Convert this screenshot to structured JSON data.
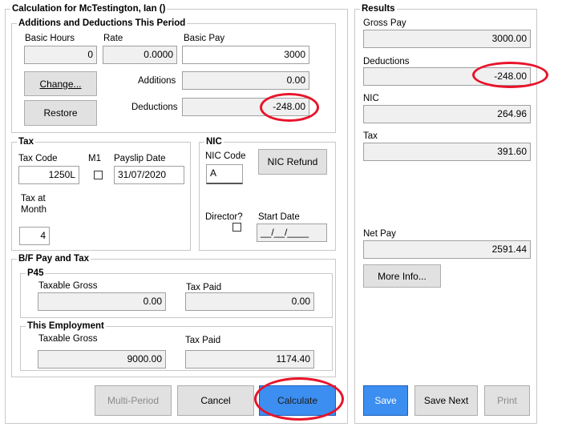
{
  "calc": {
    "title": "Calculation for McTestington, Ian ()",
    "additions_group": {
      "title": "Additions and Deductions This Period",
      "basic_hours_label": "Basic Hours",
      "basic_hours_value": "0",
      "rate_label": "Rate",
      "rate_value": "0.0000",
      "basic_pay_label": "Basic Pay",
      "basic_pay_value": "3000",
      "change_button": "Change...",
      "restore_button": "Restore",
      "additions_label": "Additions",
      "additions_value": "0.00",
      "deductions_label": "Deductions",
      "deductions_value": "-248.00"
    },
    "tax_group": {
      "title": "Tax",
      "tax_code_label": "Tax Code",
      "tax_code_value": "1250L",
      "m1_label": "M1",
      "payslip_date_label": "Payslip Date",
      "payslip_date_value": "31/07/2020",
      "tax_at_label": "Tax at",
      "month_label": "Month",
      "month_value": "4"
    },
    "nic_group": {
      "title": "NIC",
      "nic_code_label": "NIC Code",
      "nic_code_value": "A",
      "nic_refund_button": "NIC Refund",
      "director_label": "Director?",
      "start_date_label": "Start Date",
      "start_date_value": "__/__/____"
    },
    "bf_group": {
      "title": "B/F Pay and Tax",
      "p45": {
        "title": "P45",
        "taxable_gross_label": "Taxable Gross",
        "taxable_gross_value": "0.00",
        "tax_paid_label": "Tax Paid",
        "tax_paid_value": "0.00"
      },
      "this_employment": {
        "title": "This Employment",
        "taxable_gross_label": "Taxable Gross",
        "taxable_gross_value": "9000.00",
        "tax_paid_label": "Tax Paid",
        "tax_paid_value": "1174.40"
      }
    },
    "buttons": {
      "multi_period": "Multi-Period",
      "cancel": "Cancel",
      "calculate": "Calculate"
    }
  },
  "results": {
    "title": "Results",
    "gross_pay_label": "Gross Pay",
    "gross_pay_value": "3000.00",
    "deductions_label": "Deductions",
    "deductions_value": "-248.00",
    "nic_label": "NIC",
    "nic_value": "264.96",
    "tax_label": "Tax",
    "tax_value": "391.60",
    "net_pay_label": "Net Pay",
    "net_pay_value": "2591.44",
    "more_info_button": "More Info...",
    "save_button": "Save",
    "save_next_button": "Save Next",
    "print_button": "Print"
  },
  "colors": {
    "highlight_circle": "#e8142a",
    "primary_button": "#3c8ef0",
    "readonly_field": "#f0f0f0",
    "border": "#c8c8c8"
  }
}
